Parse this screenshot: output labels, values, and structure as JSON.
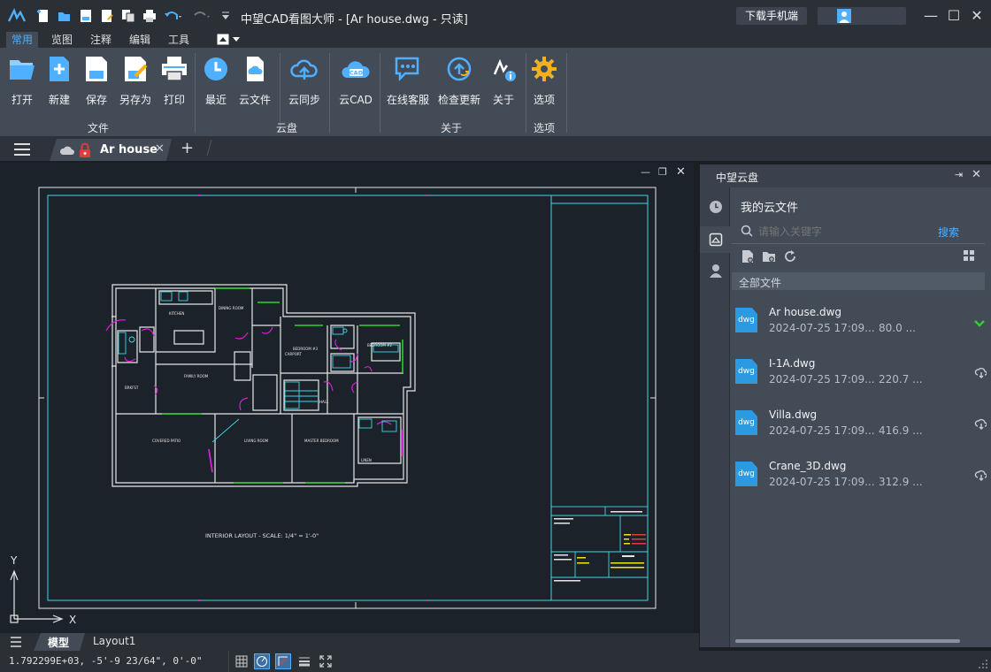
{
  "window": {
    "title": "中望CAD看图大师 - [Ar house.dwg - 只读]",
    "download_button": "下载手机端"
  },
  "quick_access": [
    "logo-icon",
    "new-icon",
    "open-icon",
    "save-icon",
    "save-as-icon",
    "copy-icon",
    "print-icon",
    "undo-icon",
    "redo-icon",
    "customize-icon"
  ],
  "menu": {
    "tabs": [
      "常用",
      "览图",
      "注释",
      "编辑",
      "工具"
    ],
    "active": "常用"
  },
  "ribbon": {
    "buttons": [
      {
        "label": "打开",
        "icon": "open-folder-icon"
      },
      {
        "label": "新建",
        "icon": "new-file-icon"
      },
      {
        "label": "保存",
        "icon": "save-icon"
      },
      {
        "label": "另存为",
        "icon": "save-as-icon"
      },
      {
        "label": "打印",
        "icon": "print-icon"
      },
      {
        "label": "最近",
        "icon": "clock-icon"
      },
      {
        "label": "云文件",
        "icon": "cloud-file-icon"
      },
      {
        "label": "云同步",
        "icon": "cloud-sync-icon"
      },
      {
        "label": "云CAD",
        "icon": "cloud-cad-icon"
      },
      {
        "label": "在线客服",
        "icon": "chat-icon"
      },
      {
        "label": "检查更新",
        "icon": "update-icon"
      },
      {
        "label": "关于",
        "icon": "about-icon"
      },
      {
        "label": "选项",
        "icon": "gear-icon"
      }
    ],
    "groups": [
      "文件",
      "云盘",
      "关于",
      "选项"
    ]
  },
  "document_tab": {
    "name": "Ar house"
  },
  "drawing": {
    "caption": "INTERIOR LAYOUT - SCALE: 1/4\" = 1'-0\"",
    "axis_x": "X",
    "axis_y": "Y",
    "rooms": [
      "FAMILY ROOM",
      "KITCHEN",
      "DINING ROOM",
      "LIVING ROOM",
      "MASTER BEDROOM",
      "BEDROOM #2",
      "BEDROOM #3",
      "HALL",
      "COVERED PATIO",
      "BRKFST",
      "CARPORT",
      "LINEN"
    ]
  },
  "cloud_panel": {
    "title": "中望云盘",
    "my_files": "我的云文件",
    "search_placeholder": "请输入关键字",
    "search_button": "搜索",
    "all_files": "全部文件",
    "files": [
      {
        "name": "Ar house.dwg",
        "date": "2024-07-25 17:09...",
        "size": "80.0 ...",
        "status": "synced"
      },
      {
        "name": "I-1A.dwg",
        "date": "2024-07-25 17:09...",
        "size": "220.7 ...",
        "status": "cloud"
      },
      {
        "name": "Villa.dwg",
        "date": "2024-07-25 17:09...",
        "size": "416.9 ...",
        "status": "cloud"
      },
      {
        "name": "Crane_3D.dwg",
        "date": "2024-07-25 17:09...",
        "size": "312.9 ...",
        "status": "cloud"
      }
    ]
  },
  "layouts": {
    "tabs": [
      "模型",
      "Layout1"
    ],
    "active": "模型"
  },
  "status": {
    "coordinates": "1.792299E+03, -5'-9 23/64\", 0'-0\""
  },
  "colors": {
    "accent": "#4fb0ff",
    "drawing_cyan": "#3fd7e6",
    "drawing_magenta": "#d91ed9",
    "drawing_green": "#2ed12e",
    "ribbon_bg": "#434b57"
  }
}
